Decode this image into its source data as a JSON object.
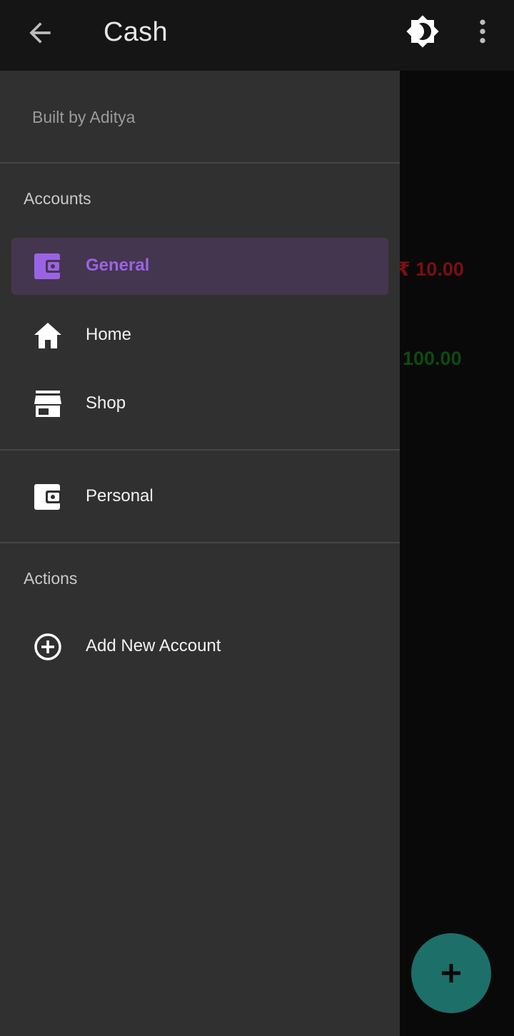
{
  "appbar": {
    "title": "Cash",
    "back_icon": "arrow-back-icon",
    "theme_icon": "brightness-icon",
    "more_icon": "more-vert-icon"
  },
  "background": {
    "amounts": [
      "₹ 10.00",
      "100.00"
    ]
  },
  "drawer": {
    "header": "Built by Aditya",
    "accounts_label": "Accounts",
    "accounts": [
      {
        "label": "General",
        "icon": "wallet-icon",
        "active": true
      },
      {
        "label": "Home",
        "icon": "home-icon",
        "active": false
      },
      {
        "label": "Shop",
        "icon": "store-icon",
        "active": false
      }
    ],
    "personal": {
      "label": "Personal",
      "icon": "wallet-icon"
    },
    "actions_label": "Actions",
    "actions": [
      {
        "label": "Add New Account",
        "icon": "add-circle-icon"
      }
    ]
  },
  "fab": {
    "icon": "plus-icon"
  },
  "colors": {
    "accent": "#9a63e4",
    "active_bg": "#44364f",
    "fab": "#1d6f69",
    "drawer_bg": "#303030",
    "expense": "#7a1010",
    "income": "#0e4a12"
  }
}
